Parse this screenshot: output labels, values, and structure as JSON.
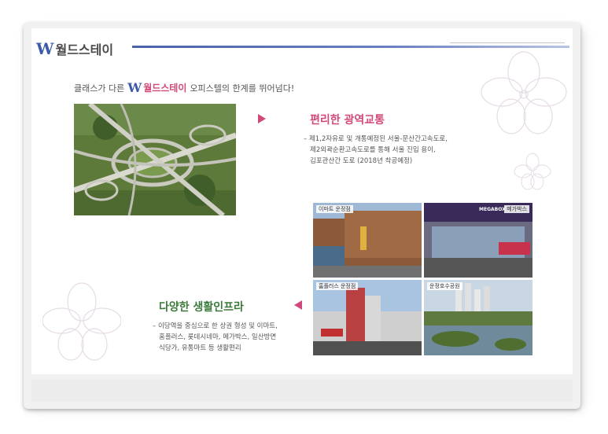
{
  "header": {
    "brand_mark": "W",
    "brand_name": "월드스테이"
  },
  "tagline": {
    "prefix": "클래스가 다른",
    "brand_mark": "W",
    "brand_name": "월드스테이",
    "suffix": "오피스텔의 한계를 뛰어넘다!"
  },
  "transport": {
    "title": "편리한 광역교통",
    "lines": [
      "– 제1,2자유로 및 개통예정된 서울-문산간고속도로,",
      "제2외곽순환고속도로를 통해 서울 진입 용이,",
      "김포관산간 도로 (2018년 착공예정)"
    ],
    "title_color": "#d1487a"
  },
  "infra": {
    "title": "다양한 생활인프라",
    "lines": [
      "– 이당역을 중심으로 한 상권 형성 및 이마트,",
      "홈플러스, 롯데시네마, 메가박스, 일산방면",
      "식당가, 유통마트 등 생활편리"
    ],
    "title_color": "#3a7a3a"
  },
  "photos": {
    "emart": "이마트 운정점",
    "megabox": "메가박스",
    "megabox_sign": "MEGABOX",
    "homeplus": "홈플러스 운정점",
    "lakepark": "운정호수공원"
  },
  "colors": {
    "accent_pink": "#d1487a",
    "accent_blue": "#3b5ba9"
  }
}
